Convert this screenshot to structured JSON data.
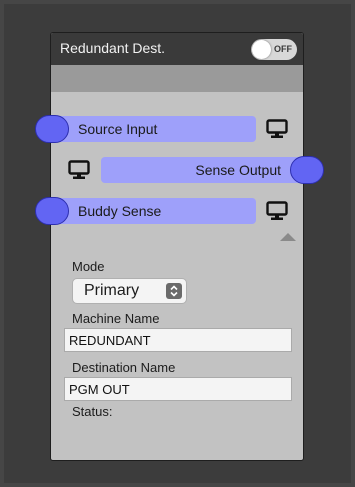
{
  "node": {
    "title": "Redundant Dest.",
    "toggle": {
      "state_label": "OFF",
      "on": false
    }
  },
  "ports": {
    "source_input": {
      "label": "Source Input",
      "color": "#9ea0fa"
    },
    "sense_output": {
      "label": "Sense Output",
      "color": "#9ea0fa"
    },
    "buddy_sense": {
      "label": "Buddy Sense",
      "color": "#9ea0fa"
    }
  },
  "fields": {
    "mode": {
      "label": "Mode",
      "value": "Primary"
    },
    "machine_name": {
      "label": "Machine Name",
      "value": "REDUNDANT"
    },
    "destination_name": {
      "label": "Destination Name",
      "value": "PGM OUT"
    },
    "status": {
      "label": "Status:"
    }
  },
  "icons": {
    "pin": "port-connector-icon",
    "monitor": "monitor-icon",
    "collapse": "collapse-up-icon",
    "select": "updown-arrows-icon"
  },
  "colors": {
    "pin_fill": "#6265f3",
    "port_fill": "#9ea0fa",
    "header": "#3a3a3a"
  }
}
